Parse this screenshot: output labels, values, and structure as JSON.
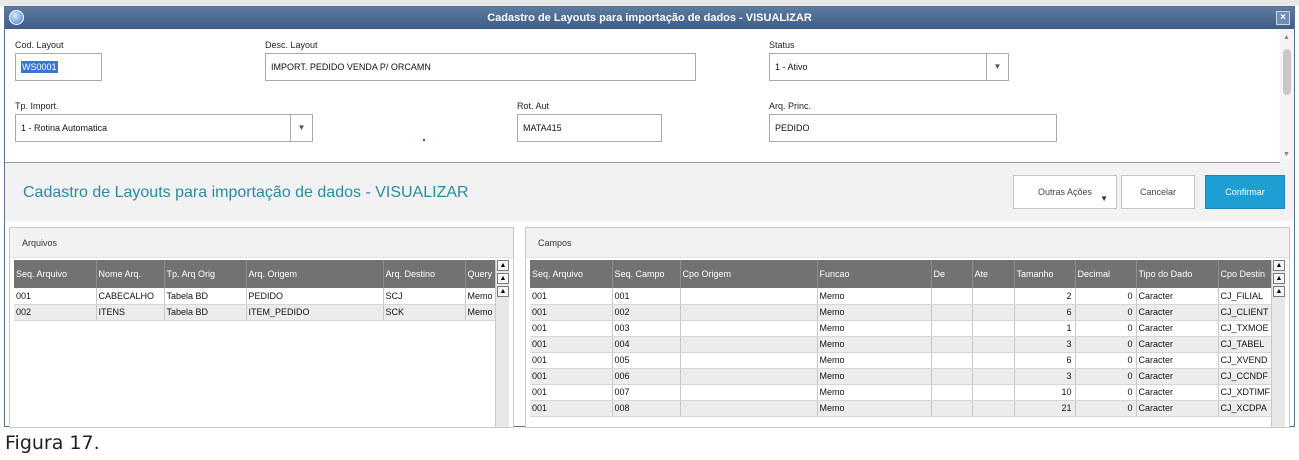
{
  "window": {
    "title": "Cadastro de Layouts para importação de dados - VISUALIZAR",
    "close_glyph": "×"
  },
  "form": {
    "cod_layout": {
      "label": "Cod. Layout",
      "value": "WS0001"
    },
    "desc_layout": {
      "label": "Desc. Layout",
      "value": "IMPORT. PEDIDO VENDA P/ ORCAMN"
    },
    "status": {
      "label": "Status",
      "value": "1 - Ativo"
    },
    "tp_import": {
      "label": "Tp. Import.",
      "value": "1 - Rotina Automatica"
    },
    "rot_aut": {
      "label": "Rot. Aut",
      "value": "MATA415"
    },
    "arq_princ": {
      "label": "Arq. Princ.",
      "value": "PEDIDO"
    }
  },
  "header": {
    "title": "Cadastro de Layouts para importação de dados - VISUALIZAR",
    "outras_acoes": "Outras Ações",
    "cancelar": "Cancelar",
    "confirmar": "Confirmar"
  },
  "arquivos": {
    "title": "Arquivos",
    "columns": [
      "Seq. Arquivo",
      "Nome Arq.",
      "Tp. Arq Orig",
      "Arq. Origem",
      "Arq. Destino",
      "Query"
    ],
    "rows": [
      [
        "001",
        "CABECALHO",
        "Tabela BD",
        "PEDIDO",
        "SCJ",
        "Memo"
      ],
      [
        "002",
        "ITENS",
        "Tabela BD",
        "ITEM_PEDIDO",
        "SCK",
        "Memo"
      ]
    ]
  },
  "campos": {
    "title": "Campos",
    "columns": [
      "Seq. Arquivo",
      "Seq. Campo",
      "Cpo Origem",
      "Funcao",
      "De",
      "Ate",
      "Tamanho",
      "Decimal",
      "Tipo do Dado",
      "Cpo Destin"
    ],
    "rows": [
      [
        "001",
        "001",
        "",
        "Memo",
        "",
        "",
        "2",
        "0",
        "Caracter",
        "CJ_FILIAL"
      ],
      [
        "001",
        "002",
        "",
        "Memo",
        "",
        "",
        "6",
        "0",
        "Caracter",
        "CJ_CLIENT"
      ],
      [
        "001",
        "003",
        "",
        "Memo",
        "",
        "",
        "1",
        "0",
        "Caracter",
        "CJ_TXMOE"
      ],
      [
        "001",
        "004",
        "",
        "Memo",
        "",
        "",
        "3",
        "0",
        "Caracter",
        "CJ_TABEL"
      ],
      [
        "001",
        "005",
        "",
        "Memo",
        "",
        "",
        "6",
        "0",
        "Caracter",
        "CJ_XVEND"
      ],
      [
        "001",
        "006",
        "",
        "Memo",
        "",
        "",
        "3",
        "0",
        "Caracter",
        "CJ_CCNDF"
      ],
      [
        "001",
        "007",
        "",
        "Memo",
        "",
        "",
        "10",
        "0",
        "Caracter",
        "CJ_XDTIMF"
      ],
      [
        "001",
        "008",
        "",
        "Memo",
        "",
        "",
        "21",
        "0",
        "Caracter",
        "CJ_XCDPA"
      ]
    ]
  },
  "caption": "Figura 17."
}
